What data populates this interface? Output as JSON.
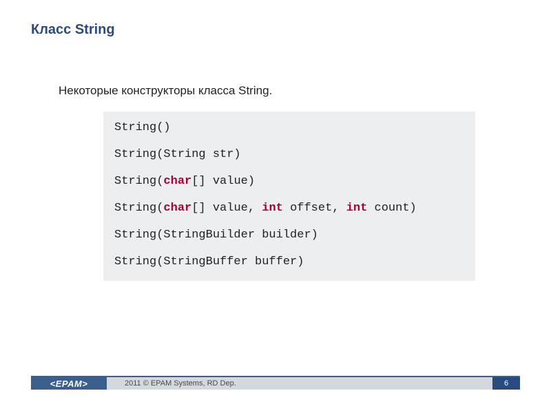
{
  "title": "Класс String",
  "subtitle": "Некоторые конструкторы класса String.",
  "code": {
    "lines": [
      [
        {
          "t": "String()"
        }
      ],
      [
        {
          "t": "String(String str)"
        }
      ],
      [
        {
          "t": "String("
        },
        {
          "t": "char",
          "kw": true
        },
        {
          "t": "[] value)"
        }
      ],
      [
        {
          "t": "String("
        },
        {
          "t": "char",
          "kw": true
        },
        {
          "t": "[] value, "
        },
        {
          "t": "int",
          "kw": true
        },
        {
          "t": " offset, "
        },
        {
          "t": "int",
          "kw": true
        },
        {
          "t": " count)"
        }
      ],
      [
        {
          "t": "String(StringBuilder builder)"
        }
      ],
      [
        {
          "t": "String(StringBuffer buffer)"
        }
      ]
    ]
  },
  "footer": {
    "logo": "<EPAM>",
    "copyright": "2011 © EPAM Systems, RD Dep.",
    "page": "6"
  }
}
